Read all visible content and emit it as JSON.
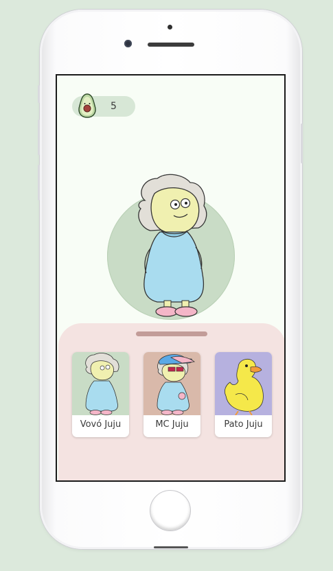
{
  "status": {
    "counter_icon": "avocado-icon",
    "counter_value": "5"
  },
  "hero": {
    "character": "vovo-juju"
  },
  "picker": {
    "cards": [
      {
        "label": "Vovó Juju",
        "bg": "#c9dcc6"
      },
      {
        "label": "MC Juju",
        "bg": "#d9b9aa"
      },
      {
        "label": "Pato Juju",
        "bg": "#b6b1df"
      }
    ]
  },
  "colors": {
    "background": "#dce9dc",
    "screen": "#f8fdf6",
    "sheet": "#f4e3e1",
    "accent": "#c29c98"
  }
}
